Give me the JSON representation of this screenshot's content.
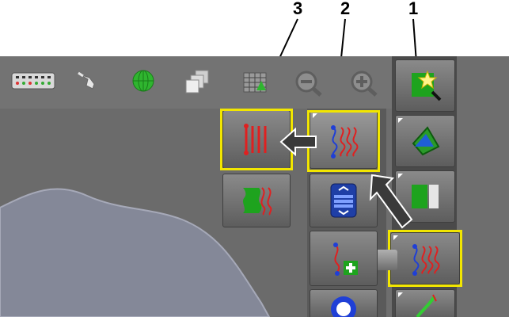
{
  "callouts": [
    {
      "label": "3"
    },
    {
      "label": "2"
    },
    {
      "label": "1"
    }
  ],
  "colors": {
    "highlight": "#f2e600",
    "screen_bg": "#6e6e6e",
    "field_shape": "#848898",
    "arrow": "#3a3a3a"
  },
  "toolbar": {
    "icons": [
      "rows-status-icon",
      "spray-nozzle-icon",
      "globe-icon",
      "layers-icon",
      "grid-map-icon",
      "zoom-out-icon",
      "zoom-in-icon",
      "map-star-icon"
    ]
  },
  "buttons": [
    {
      "icon": "parallel-straight-guidance-icon"
    },
    {
      "icon": "curved-guidance-active-icon"
    },
    {
      "icon": "curved-guidance-icon"
    },
    {
      "icon": "marker-curve-icon"
    },
    {
      "icon": "list-scroll-icon"
    },
    {
      "icon": "add-curve-icon"
    },
    {
      "icon": "boundary-icon"
    },
    {
      "icon": "headland-icon"
    },
    {
      "icon": "auto-icon"
    }
  ]
}
